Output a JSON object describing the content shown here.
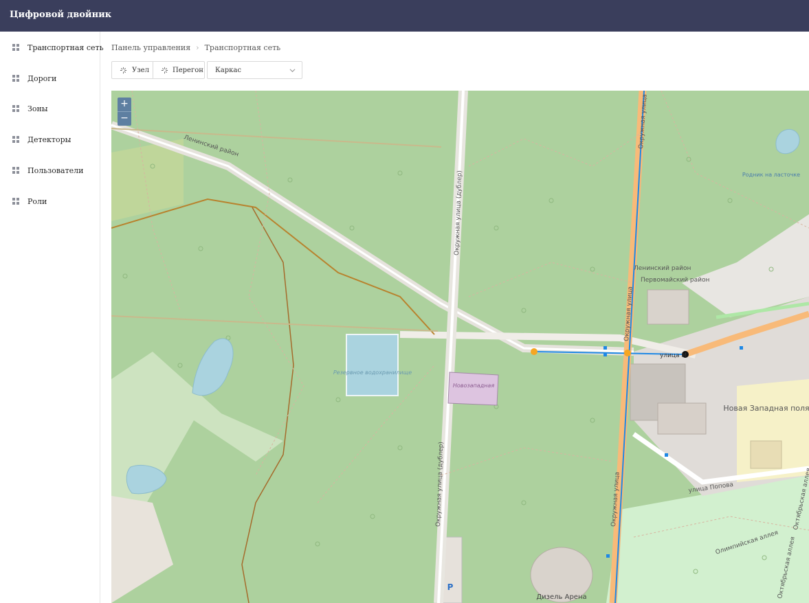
{
  "app": {
    "title": "Цифровой двойник"
  },
  "sidebar": {
    "items": [
      {
        "label": "Транспортная сеть"
      },
      {
        "label": "Дороги"
      },
      {
        "label": "Зоны"
      },
      {
        "label": "Детекторы"
      },
      {
        "label": "Пользователи"
      },
      {
        "label": "Роли"
      }
    ]
  },
  "breadcrumb": {
    "root": "Панель управления",
    "current": "Транспортная сеть"
  },
  "toolbar": {
    "node_label": "Узел",
    "segment_label": "Перегон",
    "layer_select_value": "Каркас"
  },
  "map": {
    "zoom_in": "+",
    "zoom_out": "−",
    "labels": {
      "district_lenin": "Ленинский район",
      "district_lenin2": "Ленинский район",
      "district_pervomay": "Первомайский район",
      "okruzhnaya_dubler": "Окружная улица (дублер)",
      "okruzhnaya_dubler2": "Окружная улица (дублер)",
      "okruzhnaya": "Окружная улица",
      "okruzhnaya2": "Окружная улица",
      "okruzhnaya3": "Окружная улица",
      "reservoir": "Резервное водохранилище",
      "novozapadnaya": "Новозападная",
      "street_m": "улица М",
      "new_west_glade": "Новая Западная поляна",
      "popova": "улица Попова",
      "olympic_alley": "Олимпийская аллея",
      "october_alley": "Октябрьская аллея",
      "october_alley2": "Октябрьская аллея",
      "spring": "Родник на ласточке",
      "parking": "P",
      "diesel_arena": "Дизель Арена"
    },
    "colors": {
      "forest": "#add19e",
      "route": "#1e88e5",
      "node": "#f5a623",
      "node_end": "#111111",
      "road_major": "#f8ba79"
    }
  }
}
